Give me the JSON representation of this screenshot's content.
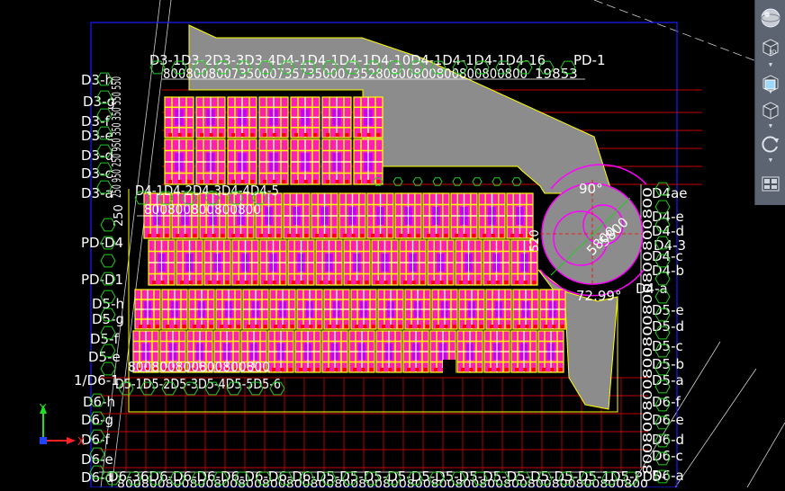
{
  "app": {
    "bg_color": "#000000",
    "frame_color": "#1a1aff",
    "accent_colors": {
      "magenta": "#ff00ff",
      "yellow": "#ffff00",
      "red": "#ff0000",
      "green": "#22cc22",
      "gray": "#8c8c8c",
      "white": "#ffffff"
    }
  },
  "labels": {
    "top_row": "D3-1D3-2D3-3D3-4D4-1D4-1D4-1D4-10D4-1D4-1D4-1D4-16",
    "top_row_nums": "800800800735000735735000735280800800800800800800",
    "pd1": "PD-1",
    "pd1_num": "19853",
    "d3": [
      "D3-h",
      "D3-g",
      "D3-f",
      "D3-e",
      "D3-d",
      "D3-c",
      "D3-b",
      "D3-a"
    ],
    "d3_nums": "250 950 250 950 350 350 550 550",
    "d4_row": "D4-1D4-2D4-3D4-4D4-5",
    "d4_row_nums": "800800800800800",
    "pd_d4": "PD-D4",
    "pd_d1": "PD-D1",
    "d5": [
      "D5-h",
      "D5-g",
      "D5-f",
      "D5-e"
    ],
    "d5_row": "D5-1D5-2D5-3D5-4D5-5D5-6",
    "d5_row_nums": "800800800800800800",
    "left_d6": "1/D6-1",
    "d6_left": [
      "D6-h",
      "D6-g",
      "D6-f",
      "D6-e",
      "D6-d"
    ],
    "bottom_row": "D6-36D6-D6-D6-D6-D6-D6-D6-D5-D5-D5-D5-D5-D5-D5-D5-D5-D5-D5-D5-1D5-PD5-",
    "bottom_nums": "800800800800800800800800800800800800800800800800800800800800800800",
    "angle_90": "90°",
    "angle_72": "72.99°",
    "radius_1": "5800",
    "radius_2": "5800",
    "right_d4": [
      "D4-e",
      "D4-d",
      "D4-3",
      "D4-c",
      "D4-b",
      "D4-a"
    ],
    "right_d5": [
      "D5-e",
      "D5-d",
      "D5-c",
      "D5-b",
      "D5-a"
    ],
    "right_d6": [
      "D6-f",
      "D6-e",
      "D6-d",
      "D6-c",
      "D6-b",
      "D6-a"
    ],
    "right_top": "D4ae",
    "right_nums": "800800800800800800800800800",
    "side_dim_1": "520",
    "side_dim_2": "250"
  },
  "navbar": {
    "buttons": [
      {
        "id": "steering-wheel",
        "icon": "globe-icon"
      },
      {
        "id": "view-3d",
        "icon": "cube-3d-icon"
      },
      {
        "id": "view-front",
        "icon": "cube-front-icon"
      },
      {
        "id": "view-box",
        "icon": "cube-icon"
      },
      {
        "id": "orbit",
        "icon": "orbit-icon"
      },
      {
        "id": "showmotion",
        "icon": "film-icon"
      }
    ]
  },
  "ucs": {
    "x_label": "X",
    "y_label": "Y"
  }
}
